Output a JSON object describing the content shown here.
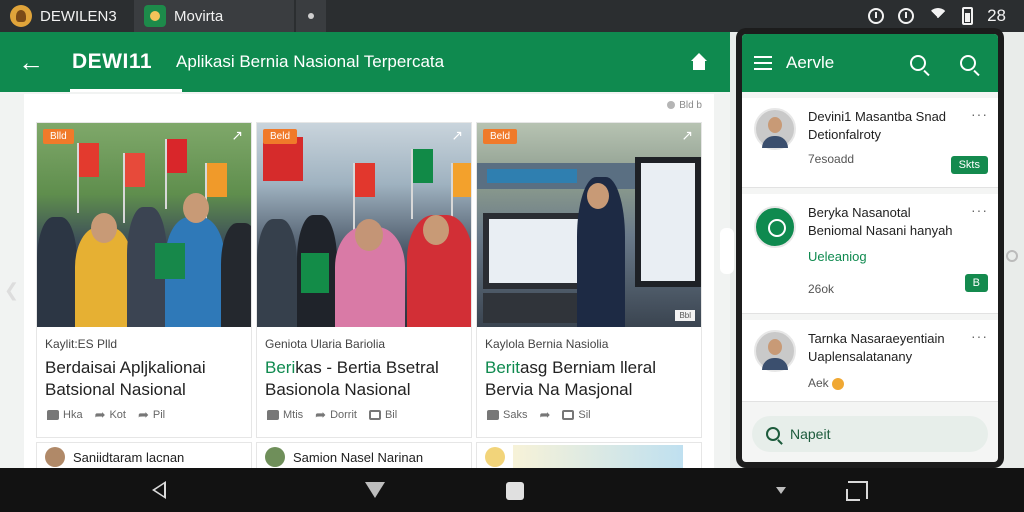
{
  "statusbar": {
    "app_name": "DEWILEN3",
    "second_tab": "Movirta",
    "time": "28"
  },
  "toolbar": {
    "brand": "DEWI11",
    "tagline": "Aplikasi Bernia Nasional Terpercata"
  },
  "content": {
    "top_label": "Bld b"
  },
  "cards": [
    {
      "badge": "Blld",
      "kicker": "Kaylit:ES Plld",
      "headline_lines": [
        "Berdaisai Apljkalionai",
        "Batsional Nasional"
      ],
      "actions": [
        "Hka",
        "Kot",
        "Pil"
      ]
    },
    {
      "badge": "Beld",
      "kicker": "Geniota Ularia Bariolia",
      "headline_green": "Beri",
      "headline_lines": [
        "kas - Bertia Bsetral",
        "Basionola Nasional"
      ],
      "actions": [
        "Mtis",
        "Dorrit",
        "Bil"
      ]
    },
    {
      "badge": "Beld",
      "tiny_tag": "Bbl",
      "kicker": "Kaylola Bernia Nasiolia",
      "headline_green": "Berit",
      "headline_lines": [
        "asg Berniam lleral",
        "Bervia Na Masjonal"
      ],
      "actions": [
        "Saks",
        "",
        "Sil"
      ]
    }
  ],
  "subcards": [
    {
      "text": "Saniidtaram lacnan"
    },
    {
      "text": "Samion Nasel Narinan"
    },
    {
      "text": ""
    }
  ],
  "phone": {
    "title": "Aervle",
    "notifications": [
      {
        "line1": "Devini1 Masantba Snad",
        "line2": "Detionfalroty",
        "time": "7esoadd",
        "button": "Skts"
      },
      {
        "line1": "Beryka Nasanotal",
        "line2": "Beniomal Nasani hanyah",
        "green": "Ueleaniog",
        "time": "26ok",
        "button": "B"
      },
      {
        "line1": "Tarnka Nasaraeyentiain",
        "line2": "Uaplensalatanany",
        "time": "Aek"
      }
    ],
    "search_label": "Napeit"
  }
}
